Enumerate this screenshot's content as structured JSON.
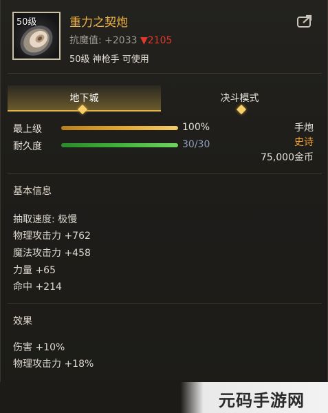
{
  "item": {
    "level_tag": "50级",
    "name": "重力之契炮",
    "resist_label": "抗魔值:",
    "resist_value": "+2033",
    "resist_change": "▼2105",
    "requirement": "50级 神枪手 可使用",
    "share_icon": "share-icon"
  },
  "tabs": [
    {
      "label": "地下城",
      "active": true
    },
    {
      "label": "决斗模式",
      "active": false
    }
  ],
  "bars": {
    "level": {
      "label": "最上级",
      "value_text": "100%",
      "fraction": 1.0,
      "color": "#e0a62e"
    },
    "durability": {
      "label": "耐久度",
      "value_text": "30/30",
      "fraction": 1.0,
      "color": "#3fb43a"
    }
  },
  "right_info": {
    "type": "手炮",
    "rarity": "史诗",
    "rarity_color": "#f0a030",
    "price": "75,000金币"
  },
  "basic_info": {
    "title": "基本信息",
    "stats": [
      "抽取速度: 极慢",
      "物理攻击力 +762",
      "魔法攻击力 +458",
      "力量 +65",
      "命中 +214"
    ]
  },
  "effects": {
    "title": "效果",
    "stats": [
      "伤害 +10%",
      "物理攻击力 +18%"
    ]
  },
  "watermark": "元码手游网"
}
